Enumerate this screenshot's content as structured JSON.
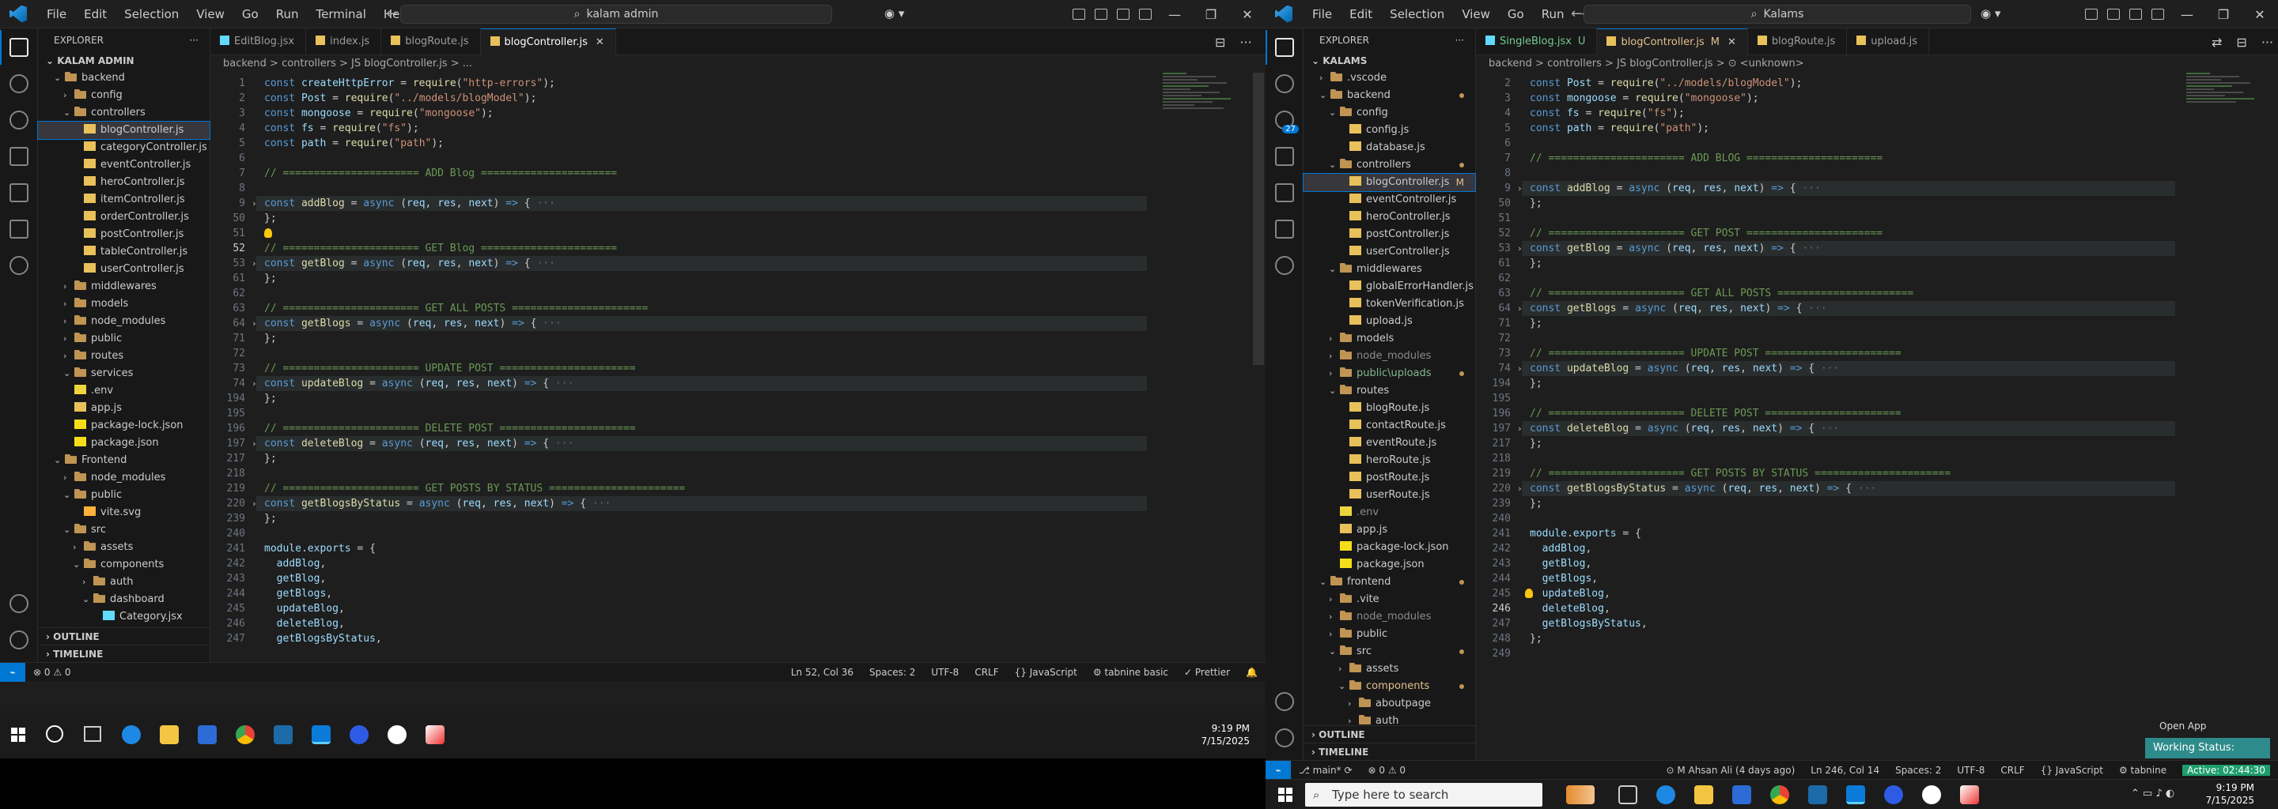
{
  "left": {
    "menu": [
      "File",
      "Edit",
      "Selection",
      "View",
      "Go",
      "Run",
      "Terminal",
      "Help"
    ],
    "search": "kalam admin",
    "explorer_title": "EXPLORER",
    "root": "KALAM ADMIN",
    "tree": [
      {
        "label": "backend",
        "type": "folder",
        "open": true,
        "depth": 1
      },
      {
        "label": "config",
        "type": "folder",
        "open": false,
        "depth": 2
      },
      {
        "label": "controllers",
        "type": "folder",
        "open": true,
        "depth": 2
      },
      {
        "label": "blogController.js",
        "type": "js",
        "depth": 3,
        "selected": true
      },
      {
        "label": "categoryController.js",
        "type": "js",
        "depth": 3
      },
      {
        "label": "eventController.js",
        "type": "js",
        "depth": 3
      },
      {
        "label": "heroController.js",
        "type": "js",
        "depth": 3
      },
      {
        "label": "itemController.js",
        "type": "js",
        "depth": 3
      },
      {
        "label": "orderController.js",
        "type": "js",
        "depth": 3
      },
      {
        "label": "postController.js",
        "type": "js",
        "depth": 3
      },
      {
        "label": "tableController.js",
        "type": "js",
        "depth": 3
      },
      {
        "label": "userController.js",
        "type": "js",
        "depth": 3
      },
      {
        "label": "middlewares",
        "type": "folder",
        "open": false,
        "depth": 2
      },
      {
        "label": "models",
        "type": "folder",
        "open": false,
        "depth": 2
      },
      {
        "label": "node_modules",
        "type": "folder",
        "open": false,
        "depth": 2
      },
      {
        "label": "public",
        "type": "folder",
        "open": false,
        "depth": 2
      },
      {
        "label": "routes",
        "type": "folder",
        "open": false,
        "depth": 2
      },
      {
        "label": "services",
        "type": "folder",
        "open": true,
        "depth": 2
      },
      {
        "label": ".env",
        "type": "env",
        "depth": 2
      },
      {
        "label": "app.js",
        "type": "js",
        "depth": 2
      },
      {
        "label": "package-lock.json",
        "type": "json",
        "depth": 2
      },
      {
        "label": "package.json",
        "type": "json",
        "depth": 2
      },
      {
        "label": "Frontend",
        "type": "folder",
        "open": true,
        "depth": 1
      },
      {
        "label": "node_modules",
        "type": "folder",
        "open": false,
        "depth": 2
      },
      {
        "label": "public",
        "type": "folder",
        "open": true,
        "depth": 2
      },
      {
        "label": "vite.svg",
        "type": "svg",
        "depth": 3
      },
      {
        "label": "src",
        "type": "folder",
        "open": true,
        "depth": 2
      },
      {
        "label": "assets",
        "type": "folder",
        "open": false,
        "depth": 3
      },
      {
        "label": "components",
        "type": "folder",
        "open": true,
        "depth": 3
      },
      {
        "label": "auth",
        "type": "folder",
        "open": false,
        "depth": 4
      },
      {
        "label": "dashboard",
        "type": "folder",
        "open": true,
        "depth": 4
      },
      {
        "label": "Category.jsx",
        "type": "jsx",
        "depth": 5
      }
    ],
    "sections": [
      "OUTLINE",
      "TIMELINE"
    ],
    "tabs": [
      {
        "label": "EditBlog.jsx",
        "type": "jsx"
      },
      {
        "label": "index.js",
        "type": "js"
      },
      {
        "label": "blogRoute.js",
        "type": "js"
      },
      {
        "label": "blogController.js",
        "type": "js",
        "active": true
      }
    ],
    "breadcrumb": "backend  >  controllers  >  JS  blogController.js  >  ...",
    "status": {
      "errors": "⊗ 0  ⚠ 0",
      "position": "Ln 52, Col 36",
      "spaces": "Spaces: 2",
      "encoding": "UTF-8",
      "eol": "CRLF",
      "language": "{} JavaScript",
      "tabnine": "⚙ tabnine basic",
      "prettier": "✓ Prettier"
    },
    "clock": {
      "time": "9:19 PM",
      "date": "7/15/2025"
    }
  },
  "right": {
    "menu": [
      "File",
      "Edit",
      "Selection",
      "View",
      "Go",
      "Run"
    ],
    "search": "Kalams",
    "explorer_title": "EXPLORER",
    "root": "KALAMS",
    "tree": [
      {
        "label": ".vscode",
        "type": "folder",
        "open": false,
        "depth": 1
      },
      {
        "label": "backend",
        "type": "folder",
        "open": true,
        "depth": 1,
        "dot": true
      },
      {
        "label": "config",
        "type": "folder",
        "open": true,
        "depth": 2
      },
      {
        "label": "config.js",
        "type": "js",
        "depth": 3
      },
      {
        "label": "database.js",
        "type": "js",
        "depth": 3
      },
      {
        "label": "controllers",
        "type": "folder",
        "open": true,
        "depth": 2,
        "dot": true
      },
      {
        "label": "blogController.js",
        "type": "js",
        "depth": 3,
        "selected": true,
        "mark": "M"
      },
      {
        "label": "eventController.js",
        "type": "js",
        "depth": 3
      },
      {
        "label": "heroController.js",
        "type": "js",
        "depth": 3
      },
      {
        "label": "postController.js",
        "type": "js",
        "depth": 3
      },
      {
        "label": "userController.js",
        "type": "js",
        "depth": 3
      },
      {
        "label": "middlewares",
        "type": "folder",
        "open": true,
        "depth": 2
      },
      {
        "label": "globalErrorHandler.js",
        "type": "js",
        "depth": 3
      },
      {
        "label": "tokenVerification.js",
        "type": "js",
        "depth": 3
      },
      {
        "label": "upload.js",
        "type": "js",
        "depth": 3
      },
      {
        "label": "models",
        "type": "folder",
        "open": false,
        "depth": 2
      },
      {
        "label": "node_modules",
        "type": "folder",
        "open": false,
        "depth": 2,
        "dim": true
      },
      {
        "label": "public\\uploads",
        "type": "folder",
        "open": false,
        "depth": 2,
        "green": true,
        "dot": true
      },
      {
        "label": "routes",
        "type": "folder",
        "open": true,
        "depth": 2
      },
      {
        "label": "blogRoute.js",
        "type": "js",
        "depth": 3
      },
      {
        "label": "contactRoute.js",
        "type": "js",
        "depth": 3
      },
      {
        "label": "eventRoute.js",
        "type": "js",
        "depth": 3
      },
      {
        "label": "heroRoute.js",
        "type": "js",
        "depth": 3
      },
      {
        "label": "postRoute.js",
        "type": "js",
        "depth": 3
      },
      {
        "label": "userRoute.js",
        "type": "js",
        "depth": 3
      },
      {
        "label": ".env",
        "type": "env",
        "depth": 2,
        "dim": true
      },
      {
        "label": "app.js",
        "type": "js",
        "depth": 2
      },
      {
        "label": "package-lock.json",
        "type": "json",
        "depth": 2
      },
      {
        "label": "package.json",
        "type": "json",
        "depth": 2
      },
      {
        "label": "frontend",
        "type": "folder",
        "open": true,
        "depth": 1,
        "dot": true
      },
      {
        "label": ".vite",
        "type": "folder",
        "open": false,
        "depth": 2
      },
      {
        "label": "node_modules",
        "type": "folder",
        "open": false,
        "depth": 2,
        "dim": true
      },
      {
        "label": "public",
        "type": "folder",
        "open": false,
        "depth": 2
      },
      {
        "label": "src",
        "type": "folder",
        "open": true,
        "depth": 2,
        "dot": true
      },
      {
        "label": "assets",
        "type": "folder",
        "open": false,
        "depth": 3
      },
      {
        "label": "components",
        "type": "folder",
        "open": true,
        "depth": 3,
        "dot": true,
        "mod": true
      },
      {
        "label": "aboutpage",
        "type": "folder",
        "open": false,
        "depth": 4
      },
      {
        "label": "auth",
        "type": "folder",
        "open": false,
        "depth": 4
      }
    ],
    "sections": [
      "OUTLINE",
      "TIMELINE"
    ],
    "tabs": [
      {
        "label": "SingleBlog.jsx",
        "type": "jsx",
        "tag": "U"
      },
      {
        "label": "blogController.js",
        "type": "js",
        "active": true,
        "tag": "M"
      },
      {
        "label": "blogRoute.js",
        "type": "js"
      },
      {
        "label": "upload.js",
        "type": "js"
      }
    ],
    "breadcrumb": "backend  >  controllers  >  JS  blogController.js  >  ⊙ <unknown>",
    "status": {
      "branch": "⎇ main*  ⟳",
      "errors": "⊗ 0 ⚠ 0",
      "blame": "⊙ M Ahsan Ali (4 days ago)",
      "position": "Ln 246, Col 14",
      "spaces": "Spaces: 2",
      "encoding": "UTF-8",
      "eol": "CRLF",
      "language": "{} JavaScript",
      "tabnine": "⚙ tabnine"
    },
    "search_placeholder": "Type here to search",
    "open_app": "Open App",
    "working_status": "Working Status: Active",
    "active_time": "Active: 02:44:30",
    "clock": {
      "time": "9:19 PM",
      "date": "7/15/2025"
    }
  }
}
